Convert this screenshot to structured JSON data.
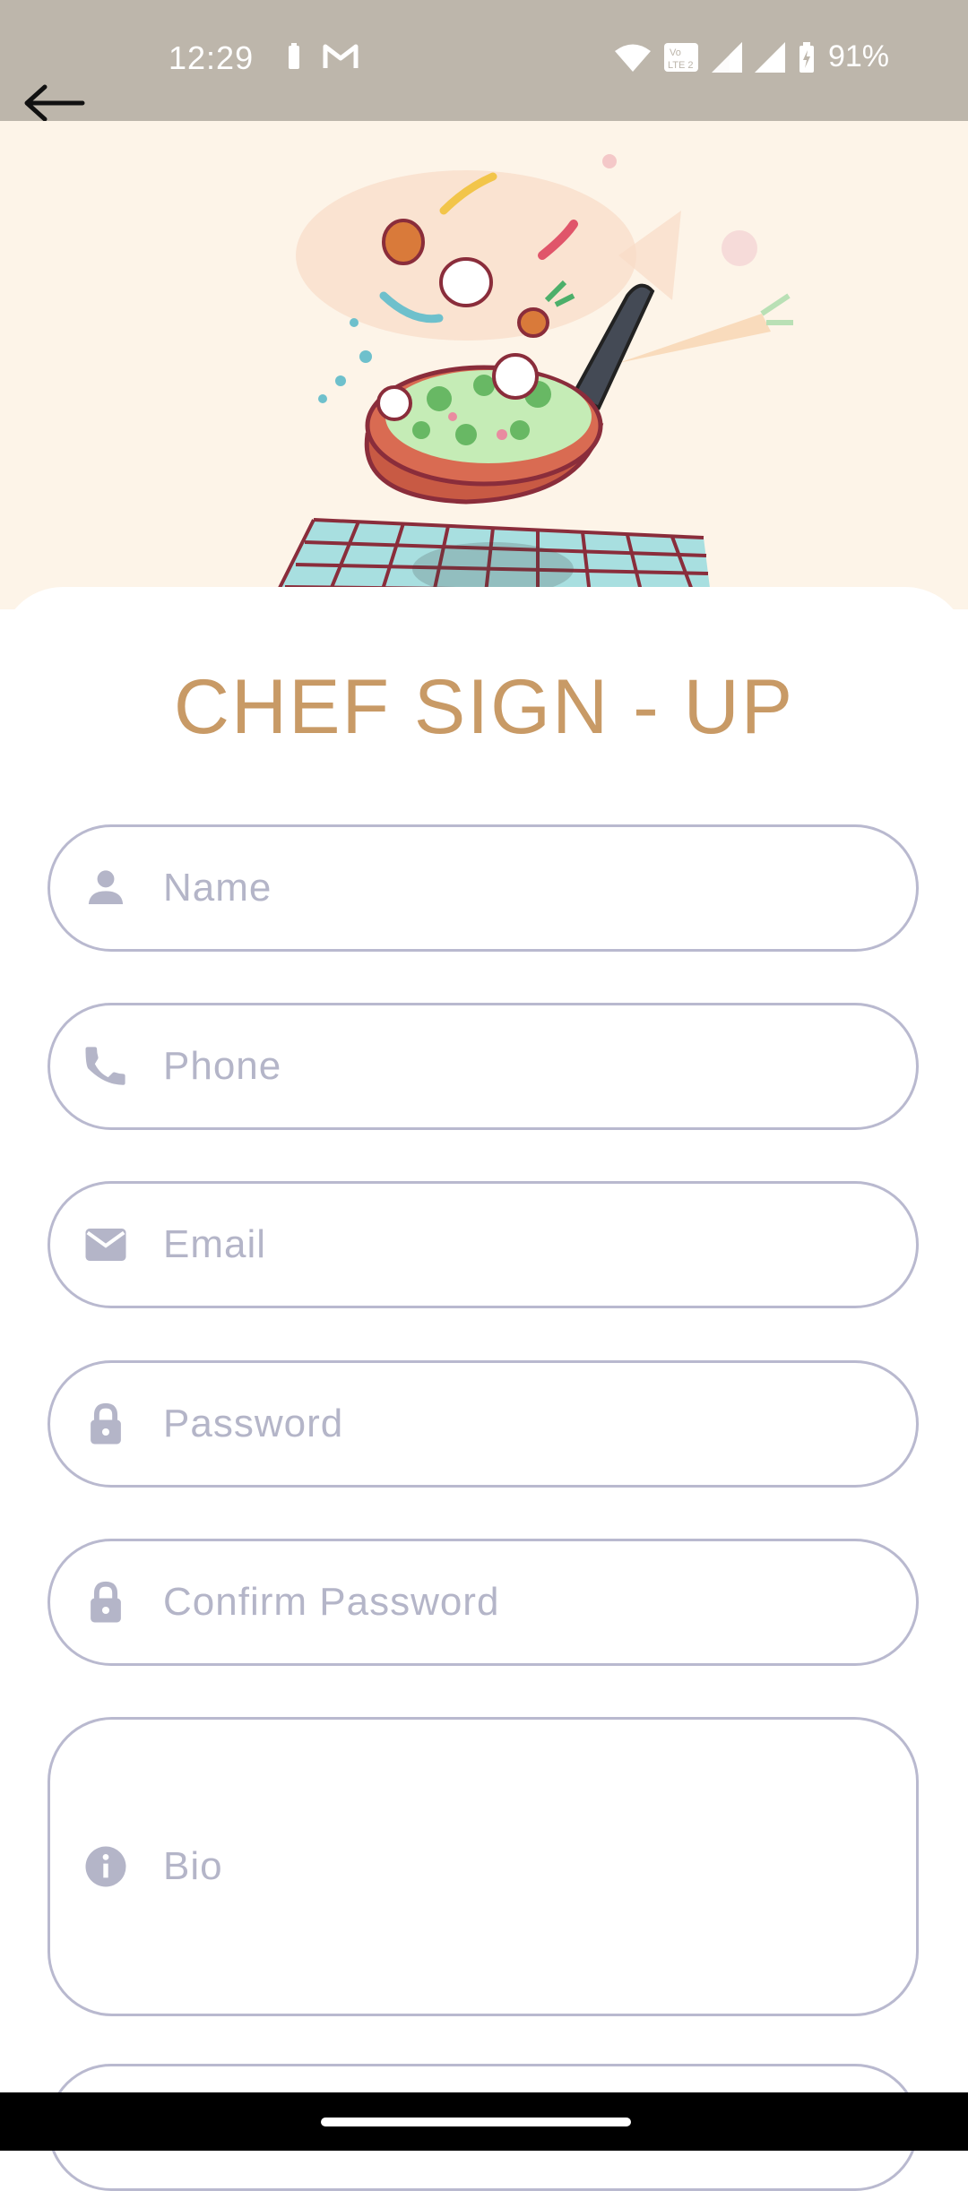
{
  "status_bar": {
    "time": "12:29",
    "battery_percent": "91%",
    "icons": [
      "battery-saver-icon",
      "gmail-icon",
      "wifi-icon",
      "volte-icon",
      "signal-icon",
      "signal-icon",
      "battery-charging-icon"
    ]
  },
  "nav": {
    "back_icon": "arrow-left-icon"
  },
  "form": {
    "title": "CHEF SIGN - UP",
    "fields": [
      {
        "label": "Name",
        "icon": "person-icon"
      },
      {
        "label": "Phone",
        "icon": "phone-icon"
      },
      {
        "label": "Email",
        "icon": "mail-icon"
      },
      {
        "label": "Password",
        "icon": "lock-icon"
      },
      {
        "label": "Confirm Password",
        "icon": "lock-icon"
      },
      {
        "label": "Bio",
        "icon": "info-icon"
      }
    ]
  },
  "colors": {
    "status_bar_bg": "#bdb6ab",
    "hero_bg": "#fdf4e8",
    "title": "#c89a66",
    "field_border": "#b9b9cf",
    "placeholder": "#b4b5c8"
  }
}
